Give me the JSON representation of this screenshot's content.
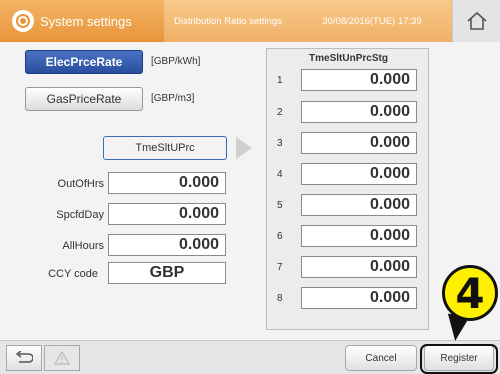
{
  "header": {
    "active_tab": "System settings",
    "inactive_tab": "Distribution Ratio settings",
    "datetime": "30/08/2016(TUE) 17:39",
    "home_icon": "home-icon",
    "settings_icon": "gear-icon"
  },
  "left": {
    "elec_button": "ElecPrceRate",
    "elec_unit": "[GBP/kWh]",
    "gas_button": "GasPriceRate",
    "gas_unit": "[GBP/m3]",
    "timeslot_button": "TmeSltUPrc",
    "rows": [
      {
        "label": "OutOfHrs",
        "value": "0.000"
      },
      {
        "label": "SpcfdDay",
        "value": "0.000"
      },
      {
        "label": "AllHours",
        "value": "0.000"
      }
    ],
    "ccy_label": "CCY code",
    "ccy_value": "GBP"
  },
  "panel": {
    "title": "TmeSltUnPrcStg",
    "slots": [
      {
        "num": "1",
        "value": "0.000"
      },
      {
        "num": "2",
        "value": "0.000"
      },
      {
        "num": "3",
        "value": "0.000"
      },
      {
        "num": "4",
        "value": "0.000"
      },
      {
        "num": "5",
        "value": "0.000"
      },
      {
        "num": "6",
        "value": "0.000"
      },
      {
        "num": "7",
        "value": "0.000"
      },
      {
        "num": "8",
        "value": "0.000"
      }
    ]
  },
  "footer": {
    "cancel": "Cancel",
    "register": "Register",
    "back_icon": "back-icon",
    "warning_icon": "warning-icon"
  },
  "callout": {
    "number": "4"
  },
  "colors": {
    "header_orange": "#e8953a",
    "header_light_orange": "#f0b068",
    "button_blue": "#2a4e9e",
    "callout_yellow": "#ffef00"
  }
}
